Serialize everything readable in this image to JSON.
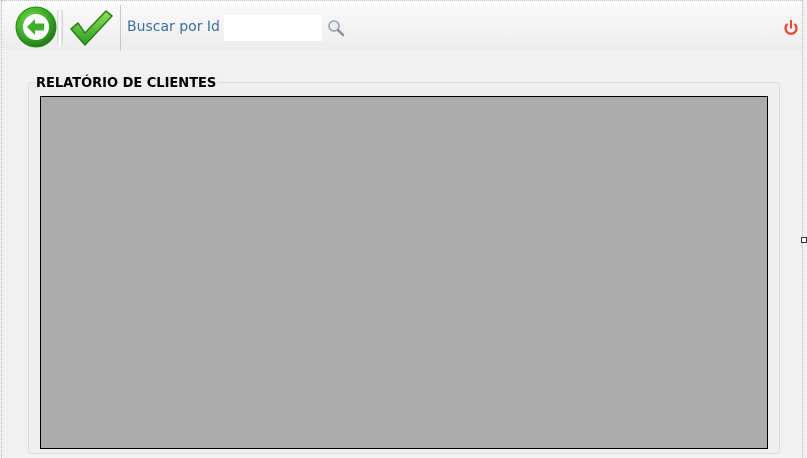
{
  "toolbar": {
    "back_icon": "arrow-left-circle-icon",
    "confirm_icon": "checkmark-icon",
    "search_label": "Buscar por Id :",
    "search_value": "",
    "search_icon": "magnifier-icon",
    "power_icon": "power-icon"
  },
  "report": {
    "title": "RELATÓRIO DE CLIENTES",
    "viewer_background": "#acacac"
  },
  "colors": {
    "back_green": "#3fae2a",
    "check_green": "#4cbc2c",
    "label_blue": "#3b6e9e",
    "power_red": "#e04a2f"
  }
}
